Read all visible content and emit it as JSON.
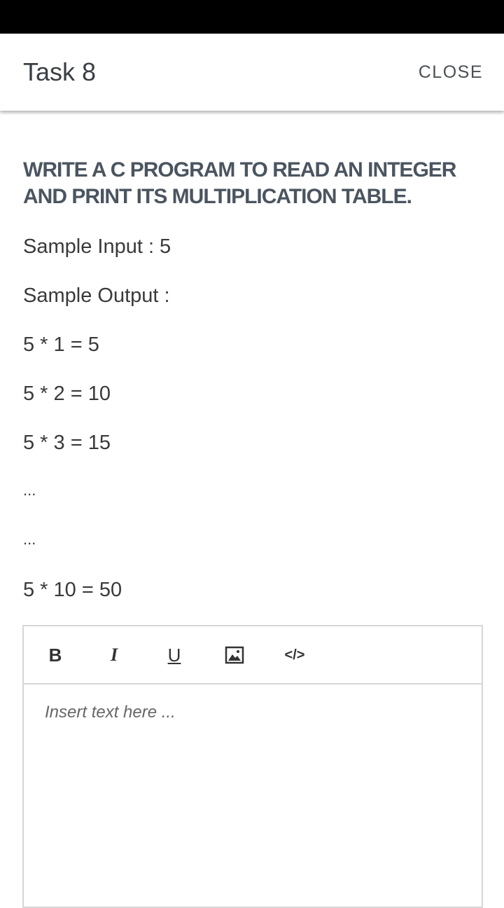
{
  "header": {
    "title": "Task 8",
    "close_label": "CLOSE"
  },
  "task": {
    "heading": "WRITE A C PROGRAM TO READ AN INTEGER AND PRINT ITS MULTIPLICATION TABLE.",
    "sample_input": "Sample Input : 5",
    "sample_output_label": "Sample Output :",
    "output_lines": [
      "5 * 1 = 5",
      "5 * 2 = 10",
      "5 * 3 = 15",
      "...",
      "...",
      "5 * 10 = 50"
    ]
  },
  "editor": {
    "toolbar": {
      "bold": "B",
      "italic": "I",
      "underline": "U",
      "image": "image-icon",
      "code": "</>"
    },
    "placeholder": "Insert text here ..."
  },
  "colors": {
    "status_bar": "#000000",
    "heading": "#4b5560",
    "border": "#d6d6d6"
  }
}
